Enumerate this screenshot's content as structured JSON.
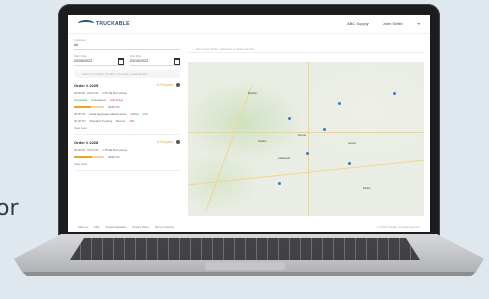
{
  "background_text": "or",
  "app": {
    "brand": "TRUCKABLE",
    "header_right": [
      "ABC Supply",
      "John Smith"
    ]
  },
  "sidebar": {
    "customer_label": "Customer",
    "customer_value": "All",
    "start_label": "Start Date",
    "start_value": "03/08/2023",
    "end_label": "End Date",
    "end_value": "03/15/2023",
    "search_placeholder": "Search by Order number, job name, material type",
    "orders": [
      {
        "title": "Order # 2225",
        "status": "In Progress",
        "time_line": "02:00:00 - 02:07:00",
        "note": "1 55 NE Red pickup",
        "sub_a": "Scheduled",
        "sub_b": "Unassigned",
        "sub_c": "Add Driver",
        "progress": 0.55,
        "progress_text": "40/40 TN",
        "rows": [
          {
            "qty": "40.00 TN",
            "name": "Road Aggregate Maintenance",
            "who": "Ashley",
            "val": "100"
          },
          {
            "qty": "40.00 TN",
            "name": "Standard Trucking",
            "who": "Benner",
            "val": "100"
          }
        ],
        "link": "View Less"
      },
      {
        "title": "Order # 2228",
        "status": "In Progress",
        "time_line": "02:00:00 - 02:07:00",
        "note": "1 55 NE Red pickup",
        "progress": 0.6,
        "progress_text": "40/40 TN",
        "link": "View more"
      }
    ]
  },
  "map": {
    "search_placeholder": "Tap to see Order, reference or plate number",
    "cities": [
      "Boulder",
      "Denver",
      "Aurora",
      "Golden",
      "Lakewood",
      "Parker"
    ]
  },
  "footer": {
    "links": [
      "About us",
      "FAQ",
      "Product Education",
      "Privacy Policy",
      "Terms of Service"
    ],
    "right": "© 2023 Truckable. All rights reserved."
  }
}
